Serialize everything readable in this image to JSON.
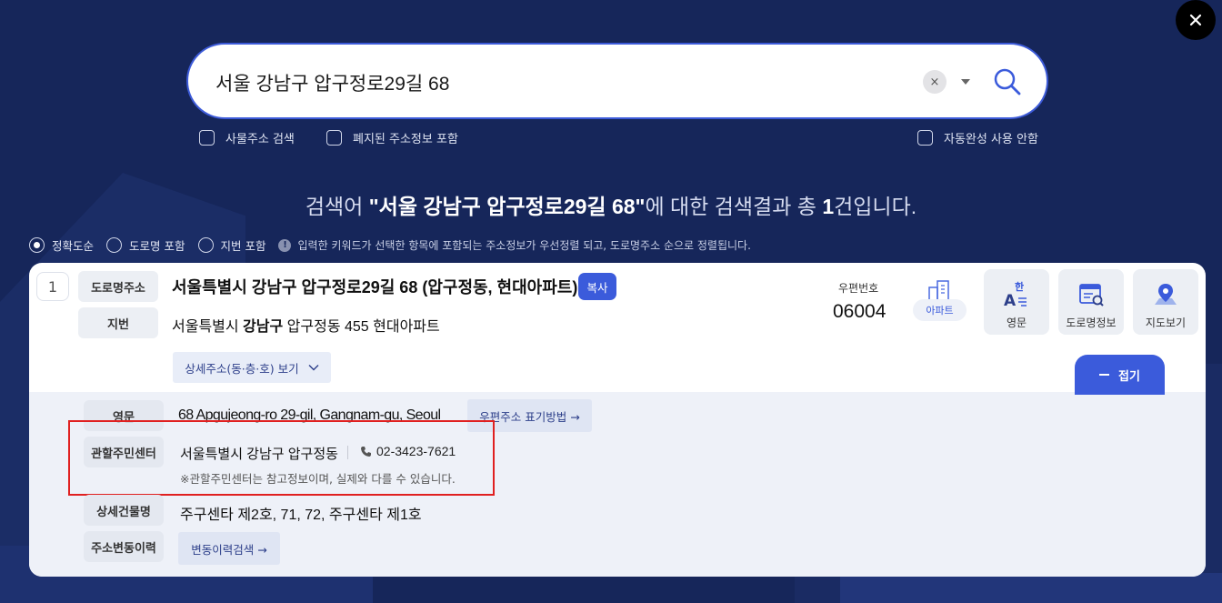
{
  "search": {
    "query": "서울 강남구 압구정로29길 68",
    "clear_symbol": "×"
  },
  "options": {
    "office_search": "사물주소 검색",
    "include_abolished": "폐지된 주소정보 포함",
    "disable_autocomplete": "자동완성 사용 안함"
  },
  "result_title": {
    "prefix": "검색어 ",
    "keyword": "\"서울 강남구 압구정로29길 68\"",
    "mid": "에 대한 검색결과 총 ",
    "count": "1",
    "suffix": "건입니다."
  },
  "sort": {
    "options": [
      "정확도순",
      "도로명 포함",
      "지번 포함"
    ],
    "selected": "정확도순",
    "note": "입력한 키워드가 선택한 항목에 포함되는 주소정보가 우선정렬 되고, 도로명주소 순으로 정렬됩니다."
  },
  "result": {
    "index": "1",
    "road_label": "도로명주소",
    "road_address": "서울특별시 강남구 압구정로29길 68 (압구정동, 현대아파트)",
    "copy_label": "복사",
    "jibun_label": "지번",
    "jibun_prefix": "서울특별시 ",
    "jibun_bold": "강남구",
    "jibun_rest": " 압구정동 455 현대아파트",
    "detail_button": "상세주소(동·층·호) 보기",
    "postal_label": "우편번호",
    "postal_code": "06004",
    "building_type": "아파트",
    "tools": [
      "영문",
      "도로명정보",
      "지도보기"
    ],
    "fold_label": "접기"
  },
  "details": {
    "english_label": "영문",
    "english_address": "68 Apgujeong-ro 29-gil, Gangnam-gu, Seoul",
    "english_link": "우편주소 표기방법 →",
    "center_label": "관할주민센터",
    "center_name": "서울특별시 강남구 압구정동",
    "center_phone": "02-3423-7621",
    "center_note": "※관할주민센터는 참고정보이며, 실제와 다를 수 있습니다.",
    "building_label": "상세건물명",
    "building_names": "주구센타 제2호, 71, 72, 주구센타 제1호",
    "history_label": "주소변동이력",
    "history_link": "변동이력검색 →"
  },
  "colors": {
    "background": "#16265a",
    "accent": "#3b5bdb",
    "highlight_box": "#e02020"
  }
}
